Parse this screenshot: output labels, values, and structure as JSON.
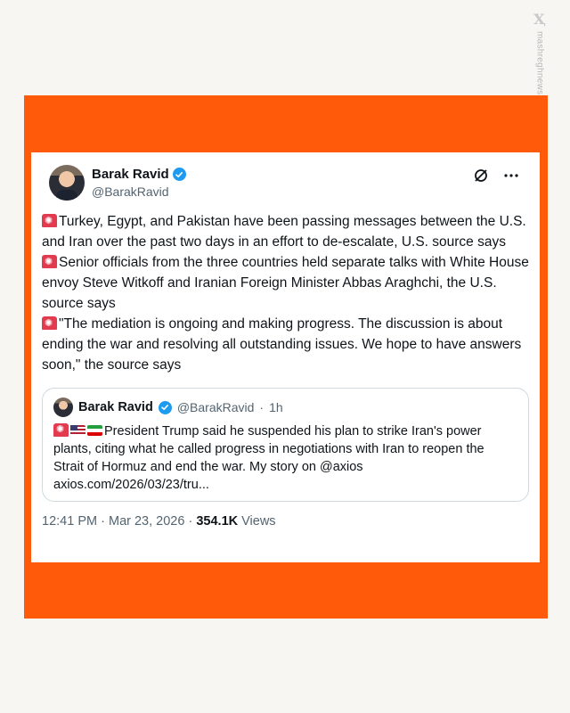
{
  "watermark": {
    "logo": "Ҳ",
    "text": "mashreghnews.ir"
  },
  "tweet": {
    "author": {
      "name": "Barak Ravid",
      "handle": "@BarakRavid"
    },
    "paragraphs": [
      "Turkey, Egypt, and Pakistan have been passing messages between the U.S. and Iran over the past two days in an effort to de-escalate, U.S. source says",
      "Senior officials from the three countries held separate talks with White House envoy Steve Witkoff and Iranian Foreign Minister Abbas Araghchi, the U.S. source says",
      "\"The mediation is ongoing and making progress. The discussion is about ending the war and resolving all outstanding issues. We hope to have answers soon,\" the source says"
    ],
    "quote": {
      "name": "Barak Ravid",
      "handle": "@BarakRavid",
      "separator": "·",
      "time": "1h",
      "text": "President Trump said he suspended his plan to strike Iran's power plants, citing what he called progress in negotiations with Iran to reopen the Strait of Hormuz and end the war. My story on @axios",
      "link": "axios.com/2026/03/23/tru..."
    },
    "meta": {
      "time": "12:41 PM",
      "dot": "·",
      "date": "Mar 23, 2026",
      "views_count": "354.1K",
      "views_label": "Views"
    }
  },
  "colors": {
    "frame": "#ff5a0a",
    "verified": "#1d9bf0",
    "muted": "#536471"
  },
  "icons": {
    "grok": "grok-icon",
    "more": "more-icon",
    "siren": "siren-emoji",
    "us_flag": "us-flag-emoji",
    "iran_flag": "iran-flag-emoji"
  }
}
